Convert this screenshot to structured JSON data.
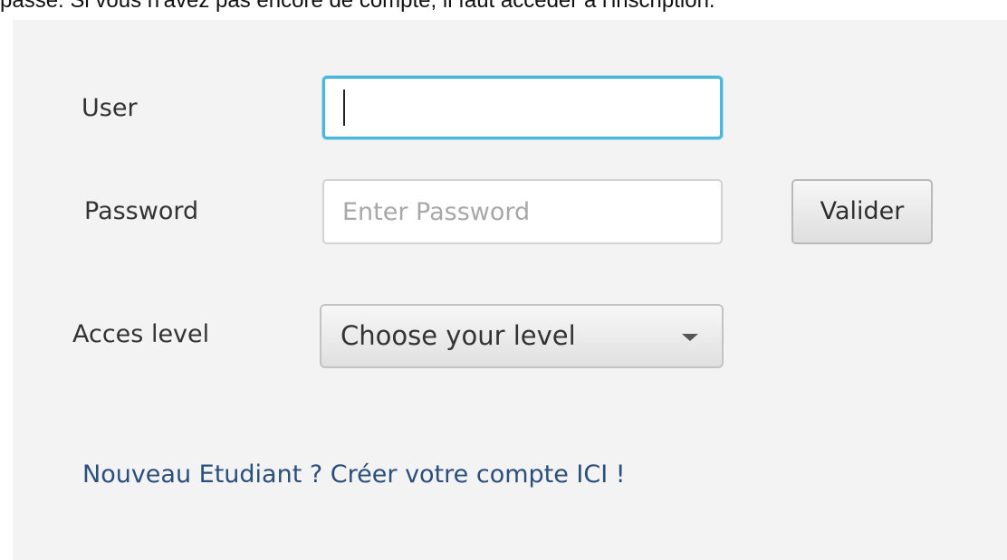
{
  "intro_text": "passe. Si vous n'avez pas encore de compte, il faut accéder à l'inscription.",
  "form": {
    "user_label": "User",
    "user_value": "",
    "password_label": "Password",
    "password_placeholder": "Enter Password",
    "submit_label": "Valider",
    "access_label": "Acces level",
    "access_selected": "Choose your level",
    "signup_link": "Nouveau Etudiant ? Créer votre compte ICI !"
  },
  "icons": {
    "dropdown": "chevron-down-icon"
  },
  "colors": {
    "panel_background": "#f3f3f3",
    "focus_border": "#4bb6d8",
    "link": "#2b4f7d",
    "placeholder": "#a8a8a8"
  }
}
